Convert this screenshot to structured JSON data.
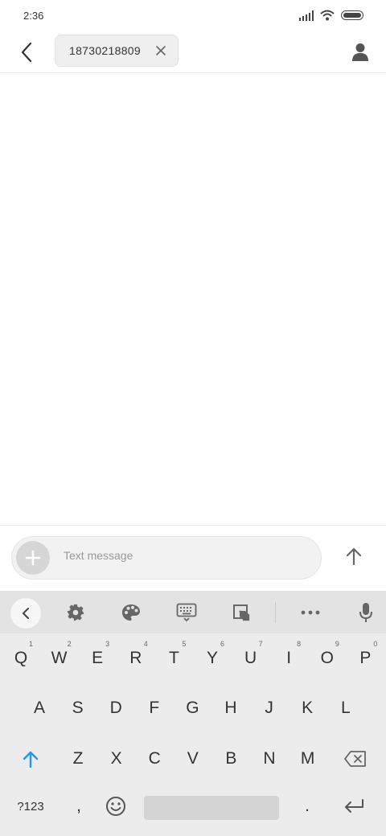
{
  "status_bar": {
    "time": "2:36"
  },
  "header": {
    "recipient": "18730218809"
  },
  "compose": {
    "placeholder": "Text message"
  },
  "keyboard": {
    "row1": [
      {
        "label": "Q",
        "hint": "1"
      },
      {
        "label": "W",
        "hint": "2"
      },
      {
        "label": "E",
        "hint": "3"
      },
      {
        "label": "R",
        "hint": "4"
      },
      {
        "label": "T",
        "hint": "5"
      },
      {
        "label": "Y",
        "hint": "6"
      },
      {
        "label": "U",
        "hint": "7"
      },
      {
        "label": "I",
        "hint": "8"
      },
      {
        "label": "O",
        "hint": "9"
      },
      {
        "label": "P",
        "hint": "0"
      }
    ],
    "row2": [
      "A",
      "S",
      "D",
      "F",
      "G",
      "H",
      "J",
      "K",
      "L"
    ],
    "row3": [
      "Z",
      "X",
      "C",
      "V",
      "B",
      "N",
      "M"
    ],
    "symbols_label": "?123",
    "comma_label": ",",
    "period_label": "."
  },
  "colors": {
    "accent": "#2196F3",
    "icon": "#555555",
    "keyboard_bg": "#ececec"
  },
  "icons": {
    "back": "chevron-left-icon",
    "chip_close": "close-icon",
    "contact": "person-icon",
    "attach": "plus-icon",
    "send": "arrow-up-icon",
    "collapse": "chevron-left-icon",
    "settings": "gear-icon",
    "theme": "palette-icon",
    "keyboard_mode": "keyboard-icon",
    "clipboard": "clipboard-icon",
    "more": "more-horizontal-icon",
    "voice": "microphone-icon",
    "shift": "shift-arrow-icon",
    "backspace": "backspace-icon",
    "emoji": "emoji-icon",
    "enter": "enter-icon"
  }
}
